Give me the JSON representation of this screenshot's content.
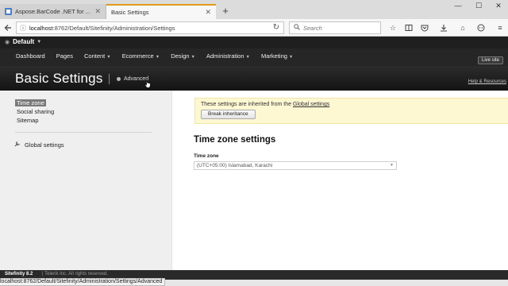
{
  "browser": {
    "tabs": [
      {
        "label": "Aspose.BarCode .NET for ...",
        "close": "✕",
        "active": false
      },
      {
        "label": "Basic Settings",
        "close": "✕",
        "active": true
      }
    ],
    "new_tab": "+",
    "window_controls": {
      "minimize": "—",
      "maximize": "☐",
      "close": "✕"
    },
    "url_host": "localhost",
    "url_path": ":8762/Default/Sitefinity/Administration/Settings",
    "search_placeholder": "Search",
    "icons": [
      "back-icon",
      "info-icon",
      "reload-icon",
      "search-icon",
      "bookmark-star-icon",
      "reading-list-icon",
      "pocket-icon",
      "download-icon",
      "home-icon",
      "chat-icon",
      "menu-icon"
    ]
  },
  "sitefinity": {
    "site_name": "Default",
    "nav": [
      {
        "label": "Dashboard",
        "has_menu": false
      },
      {
        "label": "Pages",
        "has_menu": false
      },
      {
        "label": "Content",
        "has_menu": true
      },
      {
        "label": "Ecommerce",
        "has_menu": true
      },
      {
        "label": "Design",
        "has_menu": true
      },
      {
        "label": "Administration",
        "has_menu": true
      },
      {
        "label": "Marketing",
        "has_menu": true
      }
    ],
    "live_site": "Live site",
    "page_title": "Basic Settings",
    "advanced_label": "Advanced",
    "help_link": "Help & Resources"
  },
  "sidebar": {
    "items": [
      {
        "label": "Time zone",
        "selected": true
      },
      {
        "label": "Social sharing",
        "selected": false
      },
      {
        "label": "Sitemap",
        "selected": false
      }
    ],
    "global_settings": "Global settings"
  },
  "main": {
    "notice_prefix": "These settings are inherited from the ",
    "notice_link": "Global settings",
    "break_inheritance": "Break inheritance",
    "section_title": "Time zone settings",
    "field_label": "Time zone",
    "field_value": "(UTC+05:00) Islamabad, Karachi"
  },
  "footer": {
    "version": "Sitefinity 8.2",
    "copyright": "| Telerik Inc. All rights reserved."
  },
  "status_url": "localhost:8762/Default/Sitefinity/Administration/Settings/Advanced",
  "colors": {
    "active_tab_accent": "#e09a1a",
    "sitefinity_bar": "#262626",
    "notice_bg": "#fdf7d2",
    "selected_item_bg": "#7a7a7a"
  }
}
